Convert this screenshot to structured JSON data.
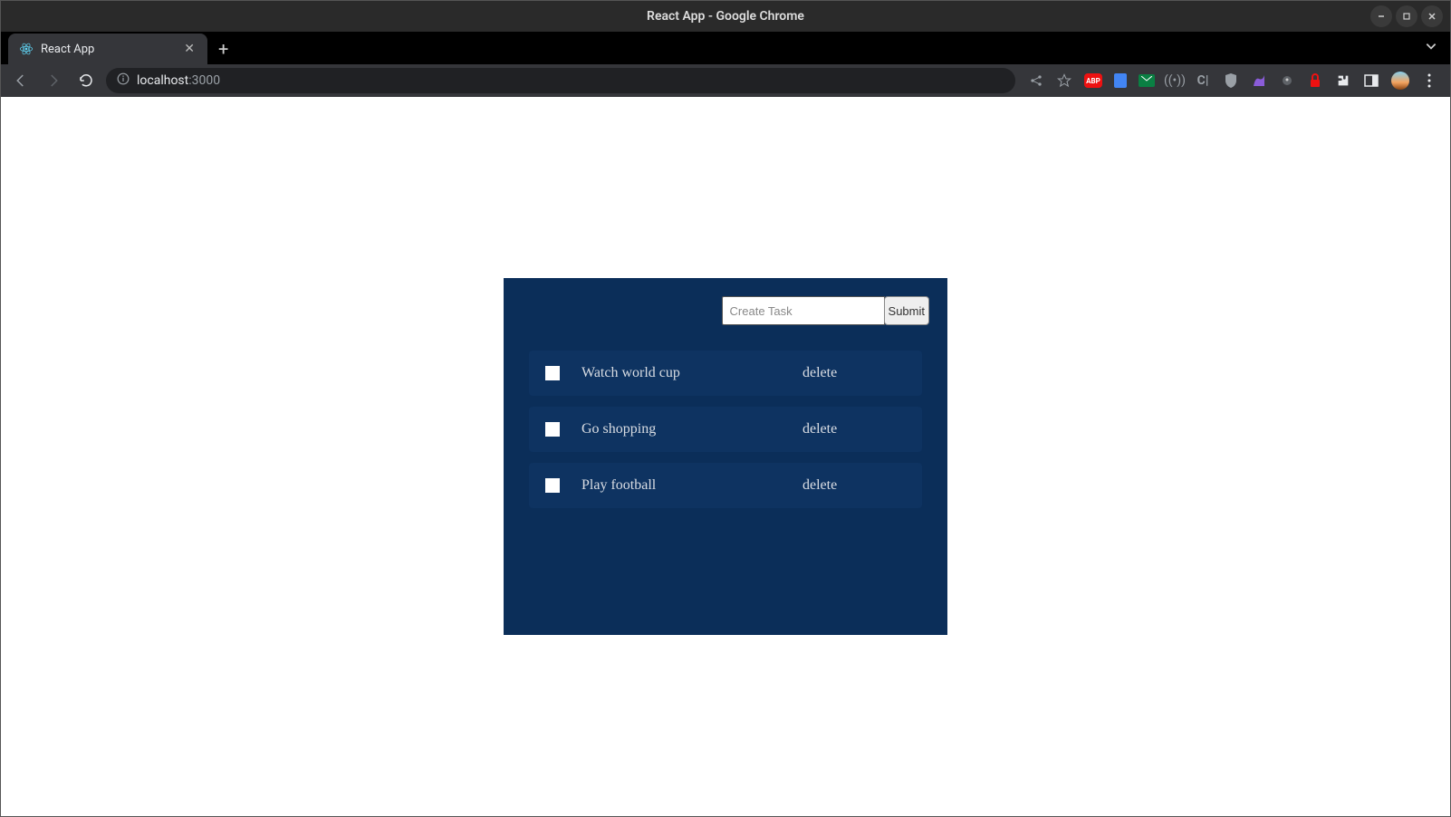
{
  "window": {
    "title": "React App - Google Chrome"
  },
  "tab": {
    "title": "React App"
  },
  "url": {
    "host": "localhost",
    "port": ":3000"
  },
  "form": {
    "placeholder": "Create Task",
    "submit_label": "Submit"
  },
  "tasks": [
    {
      "label": "Watch world cup",
      "action": "delete"
    },
    {
      "label": "Go shopping",
      "action": "delete"
    },
    {
      "label": "Play football",
      "action": "delete"
    }
  ]
}
